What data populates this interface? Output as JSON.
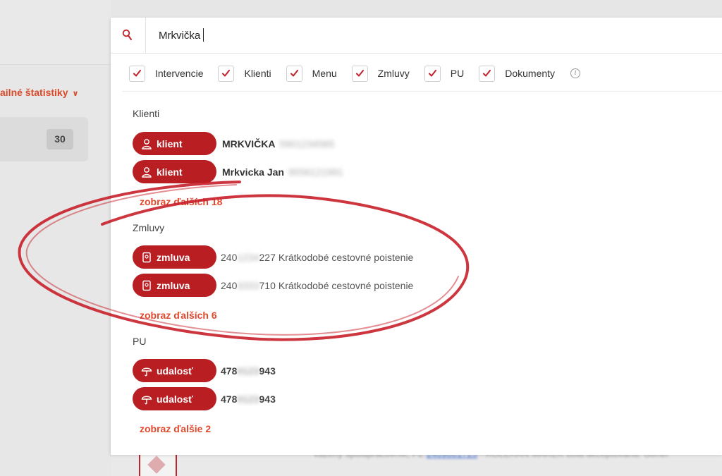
{
  "background": {
    "stats_label": "ailné štatistiky",
    "count_badge": "30",
    "bottom_text_prefix": "vázený spolupracovník, PZ",
    "bottom_text_link": "2409001725",
    "bottom_text_suffix": "- KOLEKAN MAREK bola akceptovaná. Gener"
  },
  "search": {
    "query": "Mrkvička",
    "icon": "search-icon"
  },
  "filters": [
    {
      "label": "Intervencie",
      "checked": true
    },
    {
      "label": "Klienti",
      "checked": true
    },
    {
      "label": "Menu",
      "checked": true
    },
    {
      "label": "Zmluvy",
      "checked": true
    },
    {
      "label": "PU",
      "checked": true
    },
    {
      "label": "Dokumenty",
      "checked": true
    }
  ],
  "sections": {
    "klienti": {
      "title": "Klienti",
      "items": [
        {
          "tag": "klient",
          "name": "MRKVIČKA",
          "number_visible": "590",
          "number_hidden": "1234565"
        },
        {
          "tag": "klient",
          "name": "Mrkvicka Jan",
          "number_visible": "95",
          "number_hidden": "56121991"
        }
      ],
      "more": "zobraz ďalších 18"
    },
    "zmluvy": {
      "title": "Zmluvy",
      "items": [
        {
          "tag": "zmluva",
          "number_start": "240",
          "number_hidden": "1234",
          "number_end": "227",
          "desc": "Krátkodobé cestovné poistenie"
        },
        {
          "tag": "zmluva",
          "number_start": "240",
          "number_hidden": "3333",
          "number_end": "710",
          "desc": "Krátkodobé cestovné poistenie"
        }
      ],
      "more": "zobraz ďalších 6"
    },
    "pu": {
      "title": "PU",
      "items": [
        {
          "tag": "udalosť",
          "number_start": "478",
          "number_hidden": "0123",
          "number_end": "943"
        },
        {
          "tag": "udalosť",
          "number_start": "478",
          "number_hidden": "0123",
          "number_end": "943"
        }
      ],
      "more": "zobraz ďalšie 2"
    }
  },
  "colors": {
    "brand_red": "#b81e22",
    "link_orange": "#e2482c",
    "annotation_red": "#c8202a"
  }
}
